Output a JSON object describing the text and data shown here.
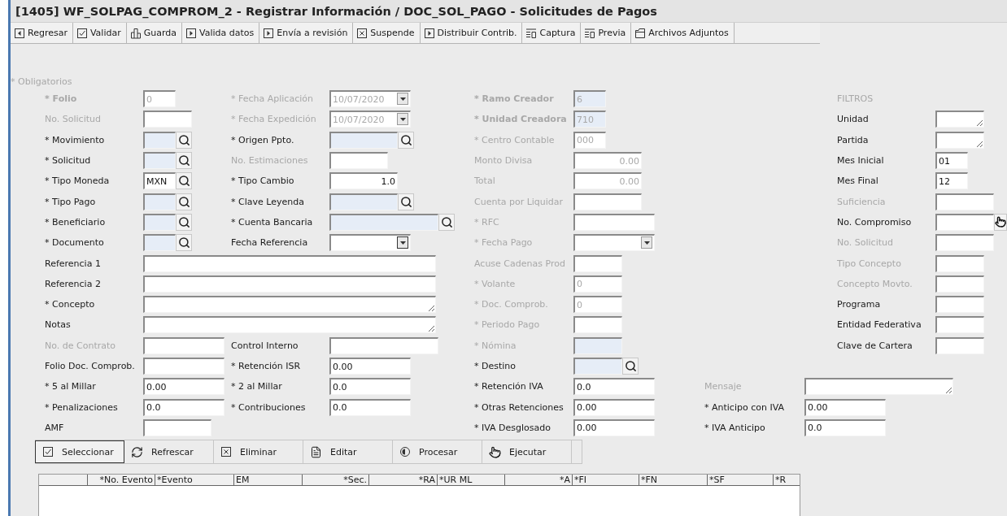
{
  "window": {
    "title": "[1405]  WF_SOLPAG_COMPROM_2 - Registrar Información / DOC_SOL_PAGO - Solicitudes de Pagos"
  },
  "toolbar": [
    {
      "label": "Regresar",
      "kind": "back"
    },
    {
      "label": "Validar",
      "kind": "check"
    },
    {
      "label": "Guarda",
      "kind": "bars"
    },
    {
      "label": "Valida datos",
      "kind": "play"
    },
    {
      "label": "Envía a revisión",
      "kind": "play"
    },
    {
      "label": "Suspende",
      "kind": "cross"
    },
    {
      "label": "Distribuir Contrib.",
      "kind": "play"
    },
    {
      "label": "Captura",
      "kind": "form"
    },
    {
      "label": "Previa",
      "kind": "form"
    },
    {
      "label": "Archivos Adjuntos",
      "kind": "folder"
    }
  ],
  "form": {
    "required_note": "* Obligatorios",
    "rows": [
      {
        "general": {
          "label": "* Folio",
          "kind": "text",
          "value": "0",
          "disabled": true,
          "bold": true,
          "highlighted": false
        },
        "dates": {
          "label": "* Fecha Aplicación",
          "kind": "date",
          "value": "10/07/2020",
          "disabled": true,
          "bold": false,
          "highlighted": false
        },
        "accounting": {
          "label": "* Ramo Creador",
          "kind": "text",
          "value": "6",
          "disabled": true,
          "bold": true,
          "highlighted": true
        },
        "filters": {
          "label": "FILTROS",
          "kind": "header",
          "disabled": true,
          "bold": false,
          "highlighted": false
        }
      },
      {
        "general": {
          "label": "No. Solicitud",
          "kind": "text",
          "disabled": true,
          "bold": false,
          "highlighted": false
        },
        "dates": {
          "label": "* Fecha Expedición",
          "kind": "date",
          "value": "10/07/2020",
          "disabled": true,
          "bold": false,
          "highlighted": false
        },
        "accounting": {
          "label": "* Unidad Creadora",
          "kind": "text",
          "value": "710",
          "disabled": true,
          "bold": true,
          "highlighted": true
        },
        "filters": {
          "label": "Unidad",
          "kind": "textarea",
          "disabled": false,
          "bold": false,
          "highlighted": false
        }
      },
      {
        "general": {
          "label": "* Movimiento",
          "kind": "lookup",
          "disabled": false,
          "bold": false,
          "highlighted": true
        },
        "dates": {
          "label": "* Origen Ppto.",
          "kind": "lookup",
          "disabled": false,
          "bold": false,
          "highlighted": true
        },
        "accounting": {
          "label": "* Centro Contable",
          "kind": "text",
          "value": "000",
          "disabled": true,
          "bold": false,
          "highlighted": false
        },
        "filters": {
          "label": "Partida",
          "kind": "textarea",
          "disabled": false,
          "bold": false,
          "highlighted": false
        }
      },
      {
        "general": {
          "label": "* Solicitud",
          "kind": "lookup",
          "disabled": false,
          "bold": false,
          "highlighted": true
        },
        "dates": {
          "label": "No. Estimaciones",
          "kind": "text",
          "disabled": true,
          "bold": false,
          "highlighted": false
        },
        "accounting": {
          "label": "Monto Divisa",
          "kind": "number",
          "value": "0.00",
          "disabled": true,
          "bold": false,
          "highlighted": false
        },
        "filters": {
          "label": "Mes Inicial",
          "kind": "text",
          "value": "01",
          "disabled": false,
          "bold": false,
          "highlighted": false
        }
      },
      {
        "general": {
          "label": "* Tipo Moneda",
          "kind": "lookup",
          "value": "MXN",
          "disabled": false,
          "bold": false,
          "highlighted": false
        },
        "dates": {
          "label": "* Tipo  Cambio",
          "kind": "number",
          "value": "1.0",
          "disabled": false,
          "bold": false,
          "highlighted": false
        },
        "accounting": {
          "label": "Total",
          "kind": "number",
          "value": "0.00",
          "disabled": true,
          "bold": false,
          "highlighted": false
        },
        "filters": {
          "label": "Mes Final",
          "kind": "text",
          "value": "12",
          "disabled": false,
          "bold": false,
          "highlighted": false
        }
      },
      {
        "general": {
          "label": "* Tipo Pago",
          "kind": "lookup",
          "disabled": false,
          "bold": false,
          "highlighted": true
        },
        "dates": {
          "label": "* Clave Leyenda",
          "kind": "lookup",
          "disabled": false,
          "bold": false,
          "highlighted": true
        },
        "accounting": {
          "label": "Cuenta por Liquidar",
          "kind": "text",
          "disabled": true,
          "bold": false,
          "highlighted": false
        },
        "filters": {
          "label": "Suficiencia",
          "kind": "text",
          "disabled": true,
          "bold": false,
          "highlighted": false
        }
      },
      {
        "general": {
          "label": "* Beneficiario",
          "kind": "lookup",
          "disabled": false,
          "bold": false,
          "highlighted": true
        },
        "dates": {
          "label": "* Cuenta Bancaria",
          "kind": "lookup",
          "disabled": false,
          "bold": false,
          "highlighted": true
        },
        "accounting": {
          "label": "* RFC",
          "kind": "text",
          "disabled": true,
          "bold": false,
          "highlighted": false
        },
        "filters": {
          "label": "No. Compromiso",
          "kind": "lock",
          "disabled": false,
          "bold": false,
          "highlighted": false
        }
      },
      {
        "general": {
          "label": "* Documento",
          "kind": "lookup",
          "disabled": false,
          "bold": false,
          "highlighted": true
        },
        "dates": {
          "label": "Fecha Referencia",
          "kind": "date",
          "disabled": false,
          "bold": false,
          "highlighted": false
        },
        "accounting": {
          "label": "* Fecha  Pago",
          "kind": "date",
          "disabled": true,
          "bold": false,
          "highlighted": false
        },
        "filters": {
          "label": "No. Solicitud",
          "kind": "text",
          "disabled": true,
          "bold": false,
          "highlighted": false
        }
      },
      {
        "general": {
          "label": "Referencia 1",
          "kind": "text",
          "disabled": false,
          "bold": false,
          "highlighted": false
        },
        "accounting": {
          "label": "Acuse Cadenas Prod",
          "kind": "text",
          "disabled": true,
          "bold": false,
          "highlighted": false
        },
        "filters": {
          "label": "Tipo Concepto",
          "kind": "text",
          "disabled": true,
          "bold": false,
          "highlighted": false
        }
      },
      {
        "general": {
          "label": "Referencia 2",
          "kind": "text",
          "disabled": false,
          "bold": false,
          "highlighted": false
        },
        "accounting": {
          "label": "* Volante",
          "kind": "text",
          "value": "0",
          "disabled": true,
          "bold": false,
          "highlighted": false
        },
        "filters": {
          "label": "Concepto Movto.",
          "kind": "text",
          "disabled": true,
          "bold": false,
          "highlighted": false
        }
      },
      {
        "general": {
          "label": "* Concepto",
          "kind": "textarea",
          "disabled": false,
          "bold": false,
          "highlighted": false
        },
        "accounting": {
          "label": "* Doc. Comprob.",
          "kind": "text",
          "value": "0",
          "disabled": true,
          "bold": false,
          "highlighted": false
        },
        "filters": {
          "label": "Programa",
          "kind": "text",
          "disabled": false,
          "bold": false,
          "highlighted": false
        }
      },
      {
        "general": {
          "label": "Notas",
          "kind": "textarea",
          "disabled": false,
          "bold": false,
          "highlighted": false
        },
        "accounting": {
          "label": "* Periodo  Pago",
          "kind": "text",
          "disabled": true,
          "bold": false,
          "highlighted": false
        },
        "filters": {
          "label": "Entidad Federativa",
          "kind": "text",
          "disabled": false,
          "bold": false,
          "highlighted": false
        }
      },
      {
        "general": {
          "label": "No. de Contrato",
          "kind": "text",
          "disabled": true,
          "bold": false,
          "highlighted": false
        },
        "dates": {
          "label": "Control Interno",
          "kind": "text",
          "disabled": false,
          "bold": false,
          "highlighted": false
        },
        "accounting": {
          "label": "* Nómina",
          "kind": "text",
          "disabled": true,
          "bold": false,
          "highlighted": true
        },
        "filters": {
          "label": "Clave de Cartera",
          "kind": "text",
          "disabled": false,
          "bold": false,
          "highlighted": false
        }
      },
      {
        "general": {
          "label": "Folio Doc. Comprob.",
          "kind": "text",
          "disabled": false,
          "bold": false,
          "highlighted": false
        },
        "dates": {
          "label": "* Retención ISR",
          "kind": "text",
          "value": "0.00",
          "disabled": false,
          "bold": false,
          "highlighted": false
        },
        "accounting": {
          "label": "* Destino",
          "kind": "lookup",
          "disabled": false,
          "bold": false,
          "highlighted": true
        }
      },
      {
        "general": {
          "label": "* 5 al Millar",
          "kind": "text",
          "value": "0.00",
          "disabled": false,
          "bold": false,
          "highlighted": false
        },
        "dates": {
          "label": "* 2 al Millar",
          "kind": "text",
          "value": "0.0",
          "disabled": false,
          "bold": false,
          "highlighted": false
        },
        "accounting": {
          "label": "* Retención IVA",
          "kind": "text",
          "value": "0.0",
          "disabled": false,
          "bold": false,
          "highlighted": false
        },
        "message": {
          "label": "Mensaje",
          "kind": "textarea",
          "disabled": true,
          "bold": false,
          "highlighted": false
        }
      },
      {
        "general": {
          "label": "* Penalizaciones",
          "kind": "text",
          "value": "0.0",
          "disabled": false,
          "bold": false,
          "highlighted": false
        },
        "dates": {
          "label": "* Contribuciones",
          "kind": "text",
          "value": "0.0",
          "disabled": false,
          "bold": false,
          "highlighted": false
        },
        "accounting": {
          "label": "* Otras Retenciones",
          "kind": "text",
          "value": "0.00",
          "disabled": false,
          "bold": false,
          "highlighted": false
        },
        "message": {
          "label": "* Anticipo con IVA",
          "kind": "text",
          "value": "0.00",
          "disabled": false,
          "bold": false,
          "highlighted": false
        }
      },
      {
        "general": {
          "label": "AMF",
          "kind": "text",
          "disabled": false,
          "bold": false,
          "highlighted": false
        },
        "accounting": {
          "label": "* IVA Desglosado",
          "kind": "text",
          "value": "0.00",
          "disabled": false,
          "bold": false,
          "highlighted": false
        },
        "message": {
          "label": "* IVA Anticipo",
          "kind": "text",
          "value": "0.0",
          "disabled": false,
          "bold": false,
          "highlighted": false
        }
      }
    ]
  },
  "actions": [
    {
      "label": "Seleccionar",
      "kind": "check",
      "selected": true
    },
    {
      "label": "Refrescar",
      "kind": "refresh",
      "selected": false
    },
    {
      "label": "Eliminar",
      "kind": "cross",
      "selected": false
    },
    {
      "label": "Editar",
      "kind": "edit",
      "selected": false
    },
    {
      "label": "Procesar",
      "kind": "process",
      "selected": false
    },
    {
      "label": "Ejecutar",
      "kind": "run",
      "selected": false
    }
  ],
  "table": {
    "columns": [
      {
        "label": "*No. Evento",
        "kind": "number"
      },
      {
        "label": "*Evento",
        "kind": "text"
      },
      {
        "label": "EM",
        "kind": "text"
      },
      {
        "label": "*Sec.",
        "kind": "number"
      },
      {
        "label": "*RA",
        "kind": "number"
      },
      {
        "label": "*UR ML",
        "kind": "text"
      },
      {
        "label": "*A",
        "kind": "number"
      },
      {
        "label": "*FI",
        "kind": "text"
      },
      {
        "label": "*FN",
        "kind": "text"
      },
      {
        "label": "*SF",
        "kind": "text"
      },
      {
        "label": "*R",
        "kind": "text"
      }
    ]
  }
}
